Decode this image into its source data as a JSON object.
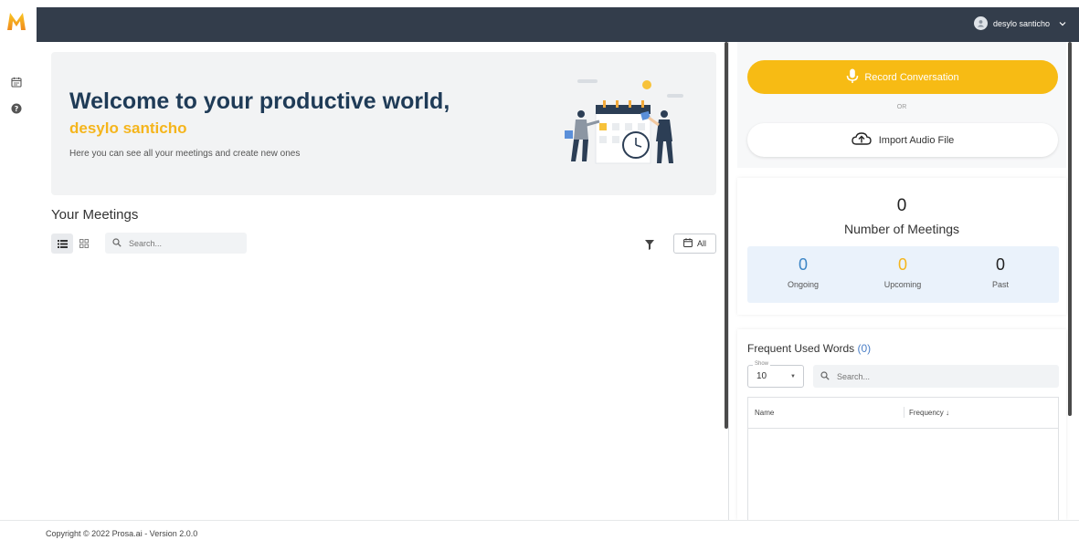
{
  "app": {
    "logo_letter": "M",
    "brand_color": "#f5b51c",
    "topbar_color": "#333d4b"
  },
  "sidebar": {
    "icons": [
      "calendar-icon",
      "help-icon"
    ]
  },
  "header": {
    "user_name": "desylo santicho"
  },
  "welcome": {
    "title": "Welcome to your productive world,",
    "user_name": "desylo santicho",
    "subtitle": "Here you can see all your meetings and create new ones"
  },
  "meetings": {
    "title": "Your Meetings",
    "search_placeholder": "Search...",
    "date_filter_label": "All"
  },
  "actions": {
    "record_label": "Record Conversation",
    "or_label": "OR",
    "import_label": "Import Audio File"
  },
  "stats": {
    "total": "0",
    "total_label": "Number of Meetings",
    "ongoing": "0",
    "ongoing_label": "Ongoing",
    "upcoming": "0",
    "upcoming_label": "Upcoming",
    "past": "0",
    "past_label": "Past",
    "ongoing_color": "#3d86c6",
    "upcoming_color": "#f5b51c"
  },
  "words": {
    "title": "Frequent Used Words",
    "count": "(0)",
    "show_label": "Show",
    "show_value": "10",
    "search_placeholder": "Search...",
    "col_name": "Name",
    "col_frequency": "Frequency"
  },
  "footer": {
    "text": "Copyright © 2022 Prosa.ai - Version 2.0.0"
  }
}
